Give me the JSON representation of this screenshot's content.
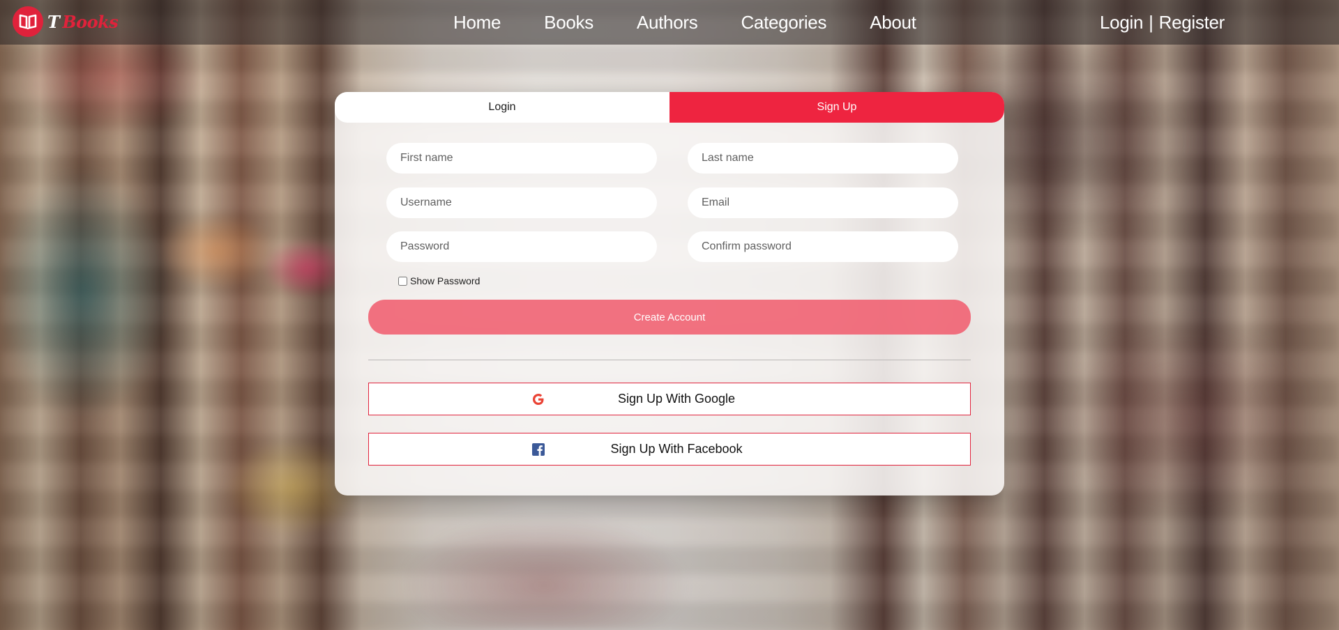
{
  "brand": {
    "prefix": "T",
    "name": "Books",
    "accent_color": "#e0223b"
  },
  "nav": {
    "links": [
      {
        "label": "Home"
      },
      {
        "label": "Books"
      },
      {
        "label": "Authors"
      },
      {
        "label": "Categories"
      },
      {
        "label": "About"
      }
    ],
    "auth": {
      "login": "Login",
      "separator": "|",
      "register": "Register"
    }
  },
  "auth_card": {
    "tabs": [
      {
        "label": "Login",
        "active": false
      },
      {
        "label": "Sign Up",
        "active": true
      }
    ],
    "fields": {
      "first_name": {
        "placeholder": "First name",
        "value": ""
      },
      "last_name": {
        "placeholder": "Last name",
        "value": ""
      },
      "username": {
        "placeholder": "Username",
        "value": ""
      },
      "email": {
        "placeholder": "Email",
        "value": ""
      },
      "password": {
        "placeholder": "Password",
        "value": ""
      },
      "confirm_password": {
        "placeholder": "Confirm password",
        "value": ""
      }
    },
    "show_password": {
      "label": "Show Password",
      "checked": false
    },
    "create_button": "Create Account",
    "social": {
      "google": {
        "label": "Sign Up With Google",
        "icon": "google-icon"
      },
      "facebook": {
        "label": "Sign Up With Facebook",
        "icon": "facebook-icon"
      }
    }
  },
  "colors": {
    "primary": "#ee2440",
    "create_button": "#f05f70",
    "facebook": "#3b5998",
    "google": "#ea4335"
  }
}
